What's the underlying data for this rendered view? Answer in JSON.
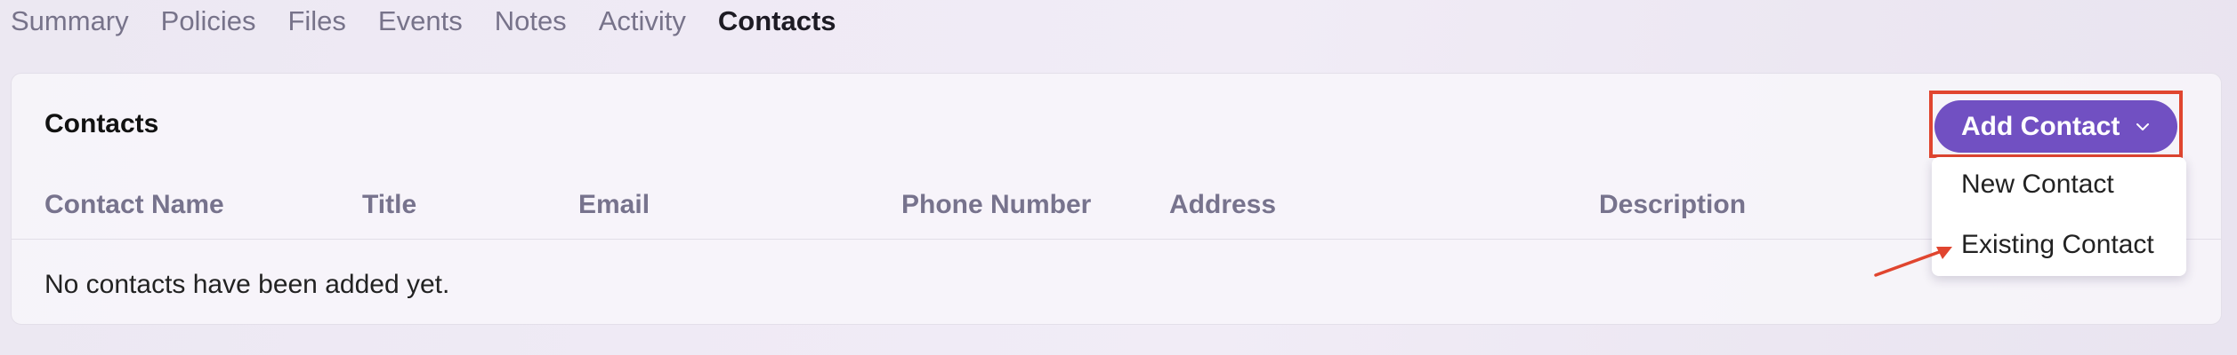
{
  "tabs": [
    "Summary",
    "Policies",
    "Files",
    "Events",
    "Notes",
    "Activity",
    "Contacts"
  ],
  "active_tab": "Contacts",
  "card": {
    "title": "Contacts",
    "columns": [
      "Contact Name",
      "Title",
      "Email",
      "Phone Number",
      "Address",
      "Description"
    ],
    "empty_message": "No contacts have been added yet."
  },
  "add_button": {
    "label": "Add Contact",
    "icon": "chevron-down-icon",
    "color": "#7150c2"
  },
  "dropdown": {
    "items": [
      "New Contact",
      "Existing Contact"
    ]
  },
  "annotation": {
    "highlight_color": "#e0452f"
  }
}
